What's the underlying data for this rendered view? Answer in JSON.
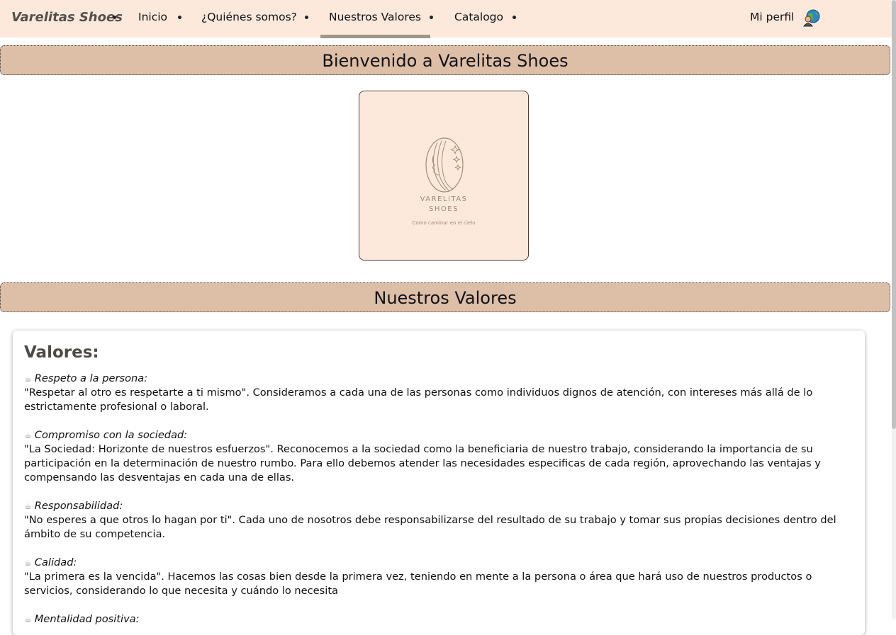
{
  "nav": {
    "brand": "Varelitas Shoes",
    "items": [
      {
        "label": "Inicio"
      },
      {
        "label": "¿Quiénes somos?"
      },
      {
        "label": "Nuestros Valores"
      },
      {
        "label": "Catalogo"
      }
    ],
    "active_item": "Nuestros Valores",
    "profile_label": "Mi perfil",
    "profile_icon": "globe-user-icon"
  },
  "banners": {
    "welcome": "Bienvenido a Varelitas Shoes",
    "values": "Nuestros Valores"
  },
  "logo": {
    "name_line1": "VARELITAS",
    "name_line2": "SHOES",
    "tagline": "Como caminar en el cielo"
  },
  "values_section": {
    "title": "Valores:",
    "item_icon": "broken-image-icon",
    "items": [
      {
        "heading": "Respeto a la persona:",
        "text": "\"Respetar al otro es respetarte a ti mismo\". Consideramos a cada una de las personas como individuos dignos de atención, con intereses más allá de lo estrictamente profesional o laboral."
      },
      {
        "heading": "Compromiso con la sociedad:",
        "text": "\"La Sociedad: Horizonte de nuestros esfuerzos\". Reconocemos a la sociedad como la beneficiaria de nuestro trabajo, considerando la importancia de su participación en la determinación de nuestro rumbo. Para ello debemos atender las necesidades especificas de cada región, aprovechando las ventajas y compensando las desventajas en cada una de ellas."
      },
      {
        "heading": "Responsabilidad:",
        "text": "\"No esperes a que otros lo hagan por ti\". Cada uno de nosotros debe responsabilizarse del resultado de su trabajo y tomar sus propias decisiones dentro del ámbito de su competencia."
      },
      {
        "heading": "Calidad:",
        "text": "\"La primera es la vencida\". Hacemos las cosas bien desde la primera vez, teniendo en mente a la persona o área que hará uso de nuestros productos o servicios, considerando lo que necesita y cuándo lo necesita"
      },
      {
        "heading": "Mentalidad positiva:",
        "text": ""
      }
    ]
  },
  "colors": {
    "nav_bg": "#fde9dc",
    "banner_bg": "#ddbea7",
    "active_underline": "#9c9889",
    "logo_card_bg": "#fde9dc"
  }
}
